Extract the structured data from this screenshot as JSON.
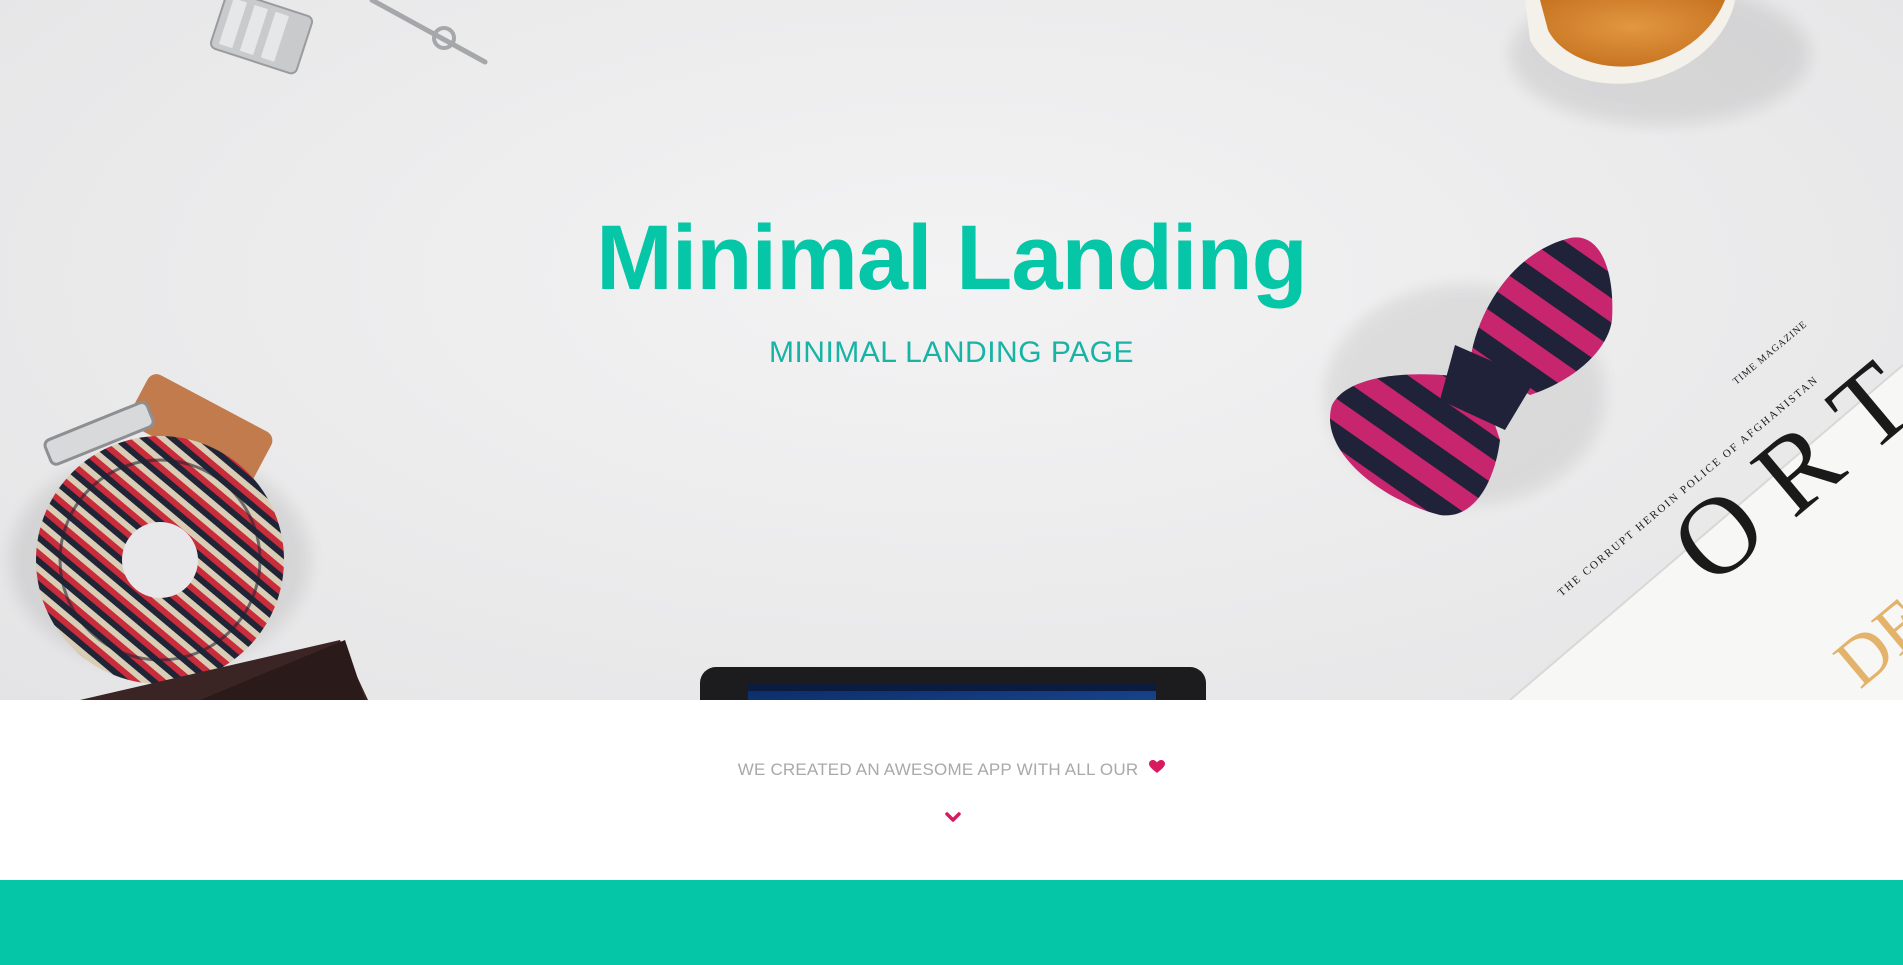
{
  "colors": {
    "accent": "#05c6a6",
    "pink": "#d81b60",
    "tagline": "#a9a9ad",
    "subtitle": "#19b3a5",
    "hero_bg": "#ebebec"
  },
  "hero": {
    "title": "Minimal Landing",
    "subtitle": "MINIMAL LANDING PAGE"
  },
  "tagline": {
    "text": "WE CREATED AN AWESOME APP WITH ALL OUR",
    "icon": "heart-icon"
  },
  "scroll": {
    "icon": "chevron-down-icon"
  }
}
